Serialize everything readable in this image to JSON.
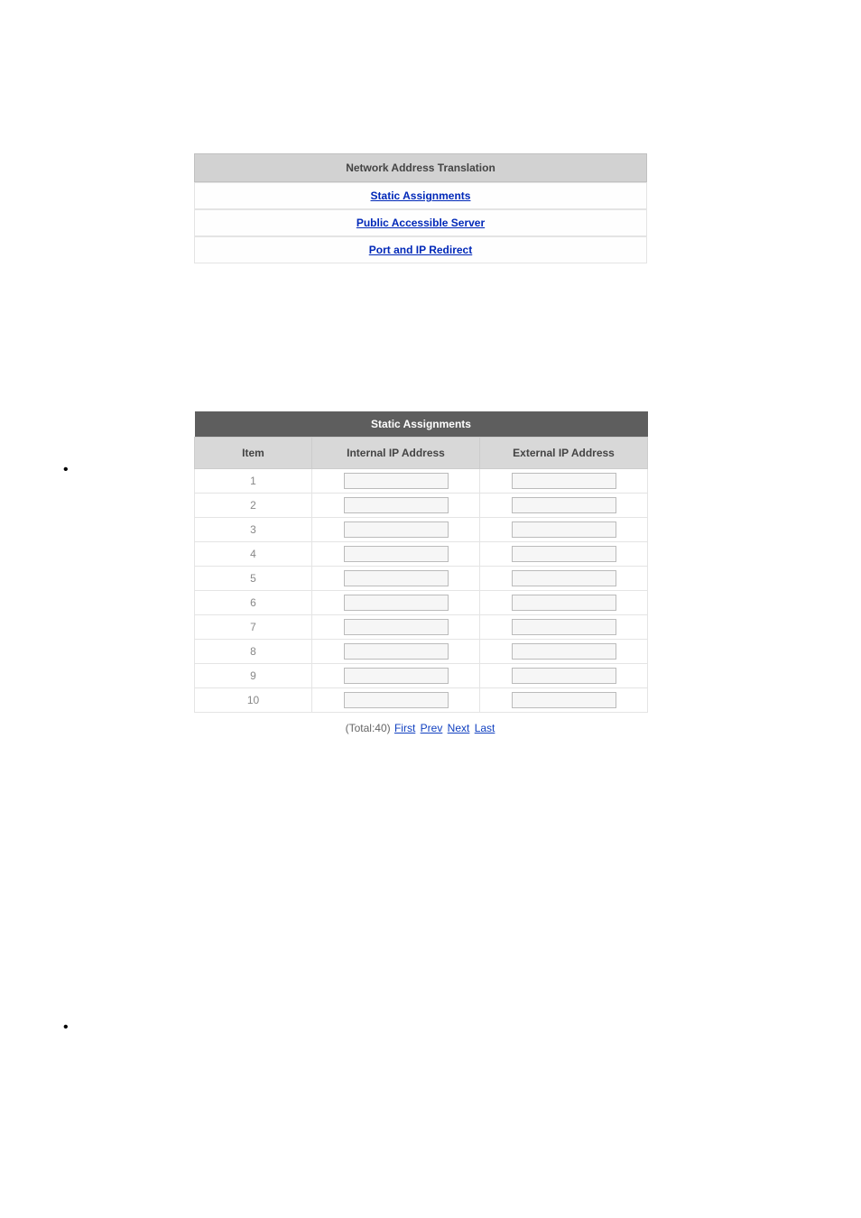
{
  "menu": {
    "header": "Network Address Translation",
    "items": [
      "Static Assignments",
      "Public Accessible Server",
      "Port and IP Redirect"
    ]
  },
  "sa": {
    "title": "Static Assignments",
    "headers": {
      "item": "Item",
      "internal": "Internal IP Address",
      "external": "External IP Address"
    },
    "rows": [
      {
        "n": "1",
        "internal": "",
        "external": ""
      },
      {
        "n": "2",
        "internal": "",
        "external": ""
      },
      {
        "n": "3",
        "internal": "",
        "external": ""
      },
      {
        "n": "4",
        "internal": "",
        "external": ""
      },
      {
        "n": "5",
        "internal": "",
        "external": ""
      },
      {
        "n": "6",
        "internal": "",
        "external": ""
      },
      {
        "n": "7",
        "internal": "",
        "external": ""
      },
      {
        "n": "8",
        "internal": "",
        "external": ""
      },
      {
        "n": "9",
        "internal": "",
        "external": ""
      },
      {
        "n": "10",
        "internal": "",
        "external": ""
      }
    ]
  },
  "pager": {
    "total_label": "(Total:40)",
    "first": "First",
    "prev": "Prev",
    "next": "Next",
    "last": "Last"
  }
}
